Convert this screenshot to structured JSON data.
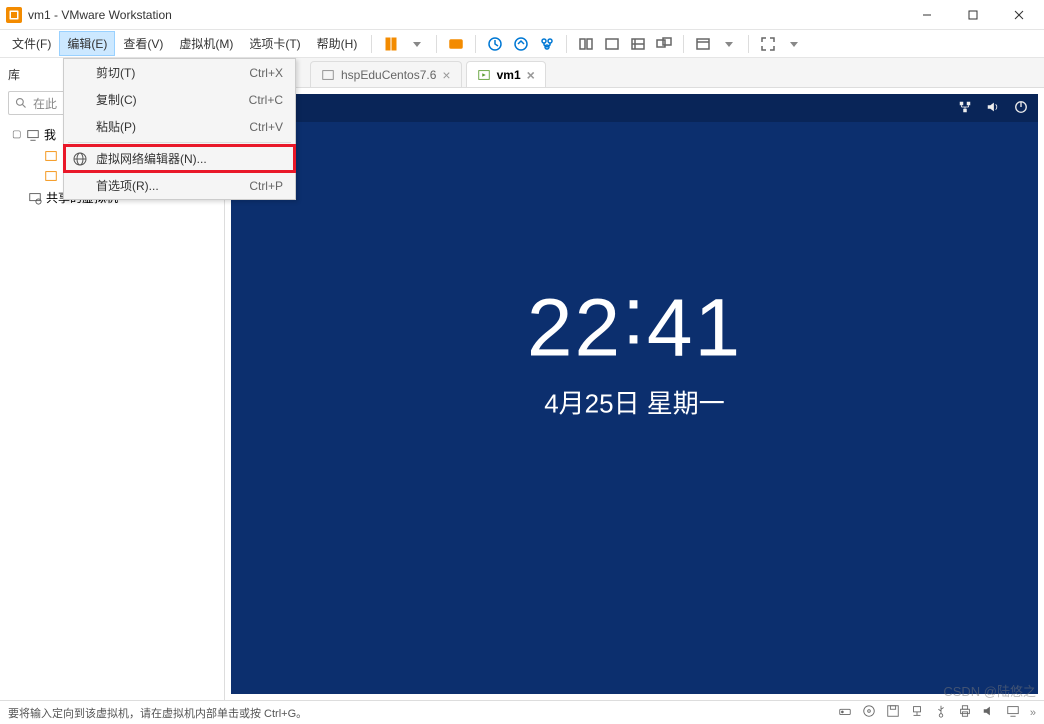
{
  "titlebar": {
    "title": "vm1 - VMware Workstation"
  },
  "menubar": {
    "items": [
      "文件(F)",
      "编辑(E)",
      "查看(V)",
      "虚拟机(M)",
      "选项卡(T)",
      "帮助(H)"
    ],
    "active_index": 1
  },
  "dropdown": {
    "items": [
      {
        "label": "剪切(T)",
        "shortcut": "Ctrl+X"
      },
      {
        "label": "复制(C)",
        "shortcut": "Ctrl+C"
      },
      {
        "label": "粘贴(P)",
        "shortcut": "Ctrl+V"
      },
      {
        "label": "虚拟网络编辑器(N)...",
        "shortcut": "",
        "icon": "globe",
        "highlighted": true
      },
      {
        "label": "首选项(R)...",
        "shortcut": "Ctrl+P"
      }
    ]
  },
  "sidebar": {
    "header": "库",
    "search_placeholder": "在此",
    "tree": {
      "root": "我",
      "children": [
        "",
        ""
      ],
      "shared": "共享的虚拟机"
    }
  },
  "tabs": [
    {
      "label": "hspEduCentos7.6",
      "active": false
    },
    {
      "label": "vm1",
      "active": true
    }
  ],
  "vm": {
    "time": "22:41",
    "time_h": "22",
    "time_m": "41",
    "date": "4月25日 星期一"
  },
  "statusbar": {
    "text": "要将输入定向到该虚拟机，请在虚拟机内部单击或按 Ctrl+G。"
  },
  "watermark": "CSDN @陆悠之"
}
